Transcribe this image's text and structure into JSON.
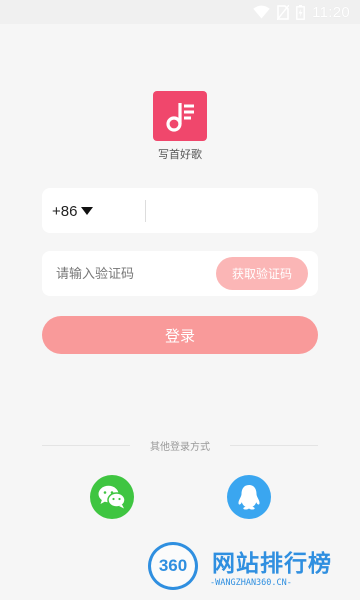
{
  "status_bar": {
    "time": "11:20",
    "icons": [
      "wifi-icon",
      "no-sim-icon",
      "battery-icon"
    ]
  },
  "app": {
    "logo_icon": "music-note-icon",
    "name": "写首好歌",
    "brand_color": "#f0476c"
  },
  "login_form": {
    "country_code": "+86",
    "phone_placeholder": "",
    "code_placeholder": "请输入验证码",
    "get_code_label": "获取验证码",
    "login_label": "登录"
  },
  "other_login": {
    "label": "其他登录方式",
    "methods": [
      {
        "name": "wechat",
        "icon": "wechat-icon",
        "color": "#3fc541"
      },
      {
        "name": "qq",
        "icon": "qq-icon",
        "color": "#3aa6f0"
      }
    ]
  },
  "watermark": {
    "badge": "360",
    "title": "网站排行榜",
    "subtitle": "-WANGZHAN360.CN-"
  }
}
